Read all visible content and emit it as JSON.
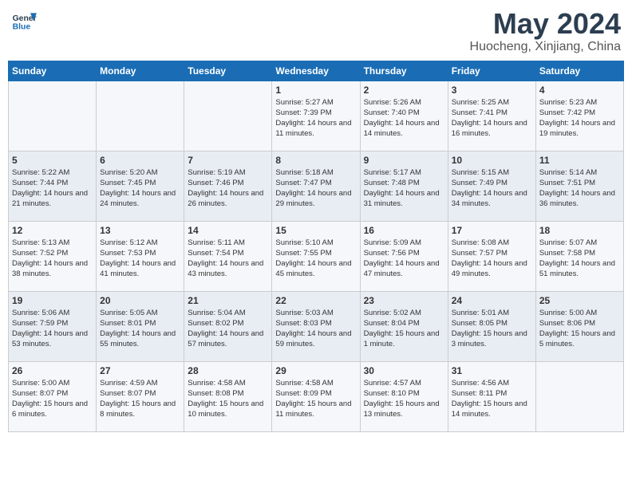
{
  "header": {
    "logo_line1": "General",
    "logo_line2": "Blue",
    "month": "May 2024",
    "location": "Huocheng, Xinjiang, China"
  },
  "weekdays": [
    "Sunday",
    "Monday",
    "Tuesday",
    "Wednesday",
    "Thursday",
    "Friday",
    "Saturday"
  ],
  "weeks": [
    [
      {
        "day": "",
        "info": ""
      },
      {
        "day": "",
        "info": ""
      },
      {
        "day": "",
        "info": ""
      },
      {
        "day": "1",
        "info": "Sunrise: 5:27 AM\nSunset: 7:39 PM\nDaylight: 14 hours\nand 11 minutes."
      },
      {
        "day": "2",
        "info": "Sunrise: 5:26 AM\nSunset: 7:40 PM\nDaylight: 14 hours\nand 14 minutes."
      },
      {
        "day": "3",
        "info": "Sunrise: 5:25 AM\nSunset: 7:41 PM\nDaylight: 14 hours\nand 16 minutes."
      },
      {
        "day": "4",
        "info": "Sunrise: 5:23 AM\nSunset: 7:42 PM\nDaylight: 14 hours\nand 19 minutes."
      }
    ],
    [
      {
        "day": "5",
        "info": "Sunrise: 5:22 AM\nSunset: 7:44 PM\nDaylight: 14 hours\nand 21 minutes."
      },
      {
        "day": "6",
        "info": "Sunrise: 5:20 AM\nSunset: 7:45 PM\nDaylight: 14 hours\nand 24 minutes."
      },
      {
        "day": "7",
        "info": "Sunrise: 5:19 AM\nSunset: 7:46 PM\nDaylight: 14 hours\nand 26 minutes."
      },
      {
        "day": "8",
        "info": "Sunrise: 5:18 AM\nSunset: 7:47 PM\nDaylight: 14 hours\nand 29 minutes."
      },
      {
        "day": "9",
        "info": "Sunrise: 5:17 AM\nSunset: 7:48 PM\nDaylight: 14 hours\nand 31 minutes."
      },
      {
        "day": "10",
        "info": "Sunrise: 5:15 AM\nSunset: 7:49 PM\nDaylight: 14 hours\nand 34 minutes."
      },
      {
        "day": "11",
        "info": "Sunrise: 5:14 AM\nSunset: 7:51 PM\nDaylight: 14 hours\nand 36 minutes."
      }
    ],
    [
      {
        "day": "12",
        "info": "Sunrise: 5:13 AM\nSunset: 7:52 PM\nDaylight: 14 hours\nand 38 minutes."
      },
      {
        "day": "13",
        "info": "Sunrise: 5:12 AM\nSunset: 7:53 PM\nDaylight: 14 hours\nand 41 minutes."
      },
      {
        "day": "14",
        "info": "Sunrise: 5:11 AM\nSunset: 7:54 PM\nDaylight: 14 hours\nand 43 minutes."
      },
      {
        "day": "15",
        "info": "Sunrise: 5:10 AM\nSunset: 7:55 PM\nDaylight: 14 hours\nand 45 minutes."
      },
      {
        "day": "16",
        "info": "Sunrise: 5:09 AM\nSunset: 7:56 PM\nDaylight: 14 hours\nand 47 minutes."
      },
      {
        "day": "17",
        "info": "Sunrise: 5:08 AM\nSunset: 7:57 PM\nDaylight: 14 hours\nand 49 minutes."
      },
      {
        "day": "18",
        "info": "Sunrise: 5:07 AM\nSunset: 7:58 PM\nDaylight: 14 hours\nand 51 minutes."
      }
    ],
    [
      {
        "day": "19",
        "info": "Sunrise: 5:06 AM\nSunset: 7:59 PM\nDaylight: 14 hours\nand 53 minutes."
      },
      {
        "day": "20",
        "info": "Sunrise: 5:05 AM\nSunset: 8:01 PM\nDaylight: 14 hours\nand 55 minutes."
      },
      {
        "day": "21",
        "info": "Sunrise: 5:04 AM\nSunset: 8:02 PM\nDaylight: 14 hours\nand 57 minutes."
      },
      {
        "day": "22",
        "info": "Sunrise: 5:03 AM\nSunset: 8:03 PM\nDaylight: 14 hours\nand 59 minutes."
      },
      {
        "day": "23",
        "info": "Sunrise: 5:02 AM\nSunset: 8:04 PM\nDaylight: 15 hours\nand 1 minute."
      },
      {
        "day": "24",
        "info": "Sunrise: 5:01 AM\nSunset: 8:05 PM\nDaylight: 15 hours\nand 3 minutes."
      },
      {
        "day": "25",
        "info": "Sunrise: 5:00 AM\nSunset: 8:06 PM\nDaylight: 15 hours\nand 5 minutes."
      }
    ],
    [
      {
        "day": "26",
        "info": "Sunrise: 5:00 AM\nSunset: 8:07 PM\nDaylight: 15 hours\nand 6 minutes."
      },
      {
        "day": "27",
        "info": "Sunrise: 4:59 AM\nSunset: 8:07 PM\nDaylight: 15 hours\nand 8 minutes."
      },
      {
        "day": "28",
        "info": "Sunrise: 4:58 AM\nSunset: 8:08 PM\nDaylight: 15 hours\nand 10 minutes."
      },
      {
        "day": "29",
        "info": "Sunrise: 4:58 AM\nSunset: 8:09 PM\nDaylight: 15 hours\nand 11 minutes."
      },
      {
        "day": "30",
        "info": "Sunrise: 4:57 AM\nSunset: 8:10 PM\nDaylight: 15 hours\nand 13 minutes."
      },
      {
        "day": "31",
        "info": "Sunrise: 4:56 AM\nSunset: 8:11 PM\nDaylight: 15 hours\nand 14 minutes."
      },
      {
        "day": "",
        "info": ""
      }
    ]
  ]
}
